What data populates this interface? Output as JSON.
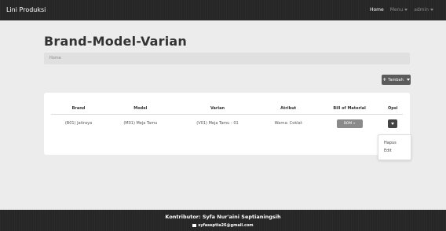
{
  "navbar": {
    "brand": "Lini Produksi",
    "home": "Home",
    "menu": "Menu",
    "user": "admin"
  },
  "page": {
    "title": "Brand-Model-Varian",
    "breadcrumb": "Home"
  },
  "toolbar": {
    "add_label": "Tambah"
  },
  "table": {
    "headers": [
      "Brand",
      "Model",
      "Varian",
      "Atribut",
      "Bill of Material",
      "Opsi"
    ],
    "rows": [
      {
        "brand": "(B01) Jatiraya",
        "model": "(M01) Meja Tamu",
        "varian": "(V01) Meja Tamu - 01",
        "atribut": "Warna: Coklat",
        "bom_label": "BOM »"
      }
    ]
  },
  "dropdown": {
    "hapus": "Hapus",
    "edit": "Edit"
  },
  "footer": {
    "contributor": "Kontributor: Syfa Nur'aini Septianingsih",
    "email": "syfaseptia26@gmail.com"
  }
}
